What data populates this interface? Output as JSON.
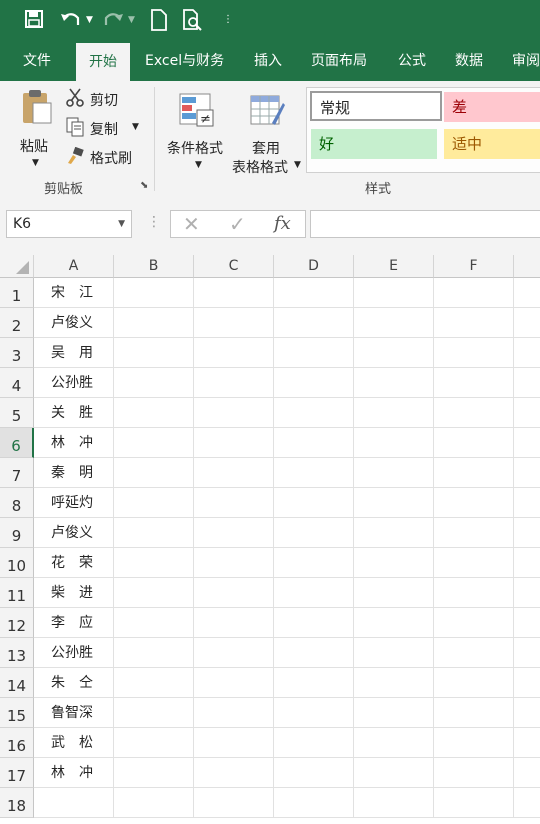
{
  "quick_access": {
    "save_icon": "save-icon",
    "undo_icon": "undo-icon",
    "redo_icon": "redo-icon",
    "new_icon": "new-document-icon",
    "preview_icon": "print-preview-icon",
    "customize_icon": "customize-quick-access-icon"
  },
  "tabs": [
    {
      "label": "文件"
    },
    {
      "label": "开始"
    },
    {
      "label": "Excel与财务"
    },
    {
      "label": "插入"
    },
    {
      "label": "页面布局"
    },
    {
      "label": "公式"
    },
    {
      "label": "数据"
    },
    {
      "label": "审阅"
    }
  ],
  "ribbon": {
    "clipboard": {
      "paste_label": "粘贴",
      "cut_label": "剪切",
      "copy_label": "复制",
      "format_painter_label": "格式刷",
      "group_label": "剪贴板"
    },
    "styles": {
      "conditional_format_label": "条件格式",
      "table_format_line1": "套用",
      "table_format_line2": "表格格式",
      "group_label": "样式",
      "cells": [
        {
          "label": "常规",
          "bg": "#ffffff",
          "color": "#262626"
        },
        {
          "label": "差",
          "bg": "#ffc7ce",
          "color": "#9c0006"
        },
        {
          "label": "好",
          "bg": "#c6efce",
          "color": "#006100"
        },
        {
          "label": "适中",
          "bg": "#ffeb9c",
          "color": "#9c5700"
        }
      ]
    }
  },
  "formula_bar": {
    "name_box": "K6",
    "fx_label": "fx",
    "formula": ""
  },
  "sheet": {
    "columns": [
      "A",
      "B",
      "C",
      "D",
      "E",
      "F"
    ],
    "selected_row": 6,
    "rows": [
      {
        "num": "1",
        "a": "宋　江"
      },
      {
        "num": "2",
        "a": "卢俊义"
      },
      {
        "num": "3",
        "a": "吴　用"
      },
      {
        "num": "4",
        "a": "公孙胜"
      },
      {
        "num": "5",
        "a": "关　胜"
      },
      {
        "num": "6",
        "a": "林　冲"
      },
      {
        "num": "7",
        "a": "秦　明"
      },
      {
        "num": "8",
        "a": "呼延灼"
      },
      {
        "num": "9",
        "a": "卢俊义"
      },
      {
        "num": "10",
        "a": "花　荣"
      },
      {
        "num": "11",
        "a": "柴　进"
      },
      {
        "num": "12",
        "a": "李　应"
      },
      {
        "num": "13",
        "a": "公孙胜"
      },
      {
        "num": "14",
        "a": "朱　仝"
      },
      {
        "num": "15",
        "a": "鲁智深"
      },
      {
        "num": "16",
        "a": "武　松"
      },
      {
        "num": "17",
        "a": "林　冲"
      },
      {
        "num": "18",
        "a": ""
      }
    ]
  },
  "colors": {
    "brand_green": "#217346"
  }
}
